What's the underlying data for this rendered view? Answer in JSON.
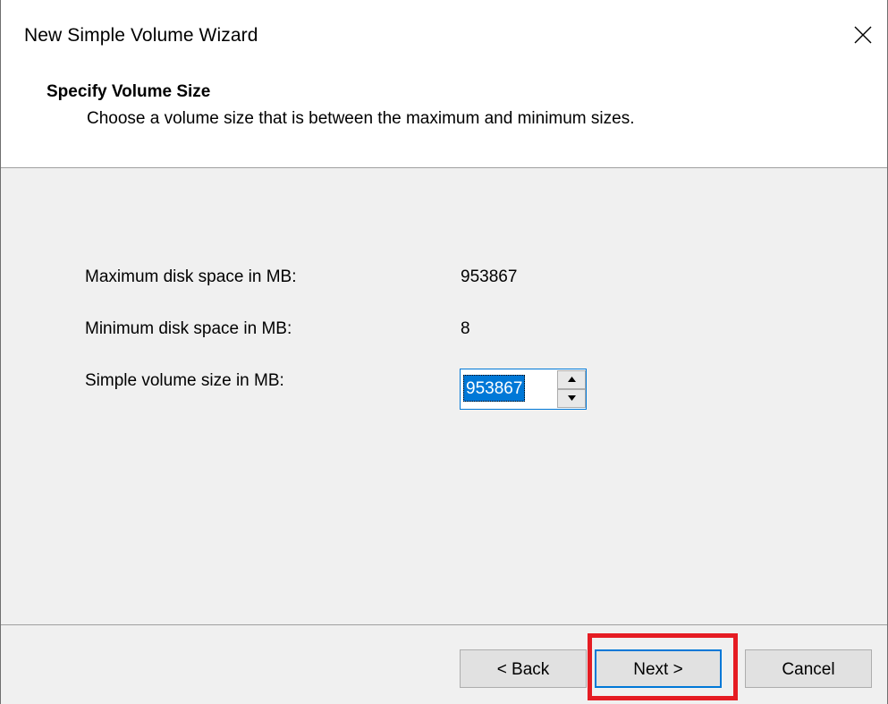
{
  "window": {
    "title": "New Simple Volume Wizard"
  },
  "header": {
    "title": "Specify Volume Size",
    "subtitle": "Choose a volume size that is between the maximum and minimum sizes."
  },
  "fields": {
    "max_label": "Maximum disk space in MB:",
    "max_value": "953867",
    "min_label": "Minimum disk space in MB:",
    "min_value": "8",
    "size_label": "Simple volume size in MB:",
    "size_value": "953867"
  },
  "buttons": {
    "back": "< Back",
    "next": "Next >",
    "cancel": "Cancel"
  },
  "icons": {
    "close": "close-icon",
    "spin_up": "arrow-up-icon",
    "spin_down": "arrow-down-icon"
  },
  "colors": {
    "highlight": "#e51c23",
    "selection": "#0078d7"
  }
}
